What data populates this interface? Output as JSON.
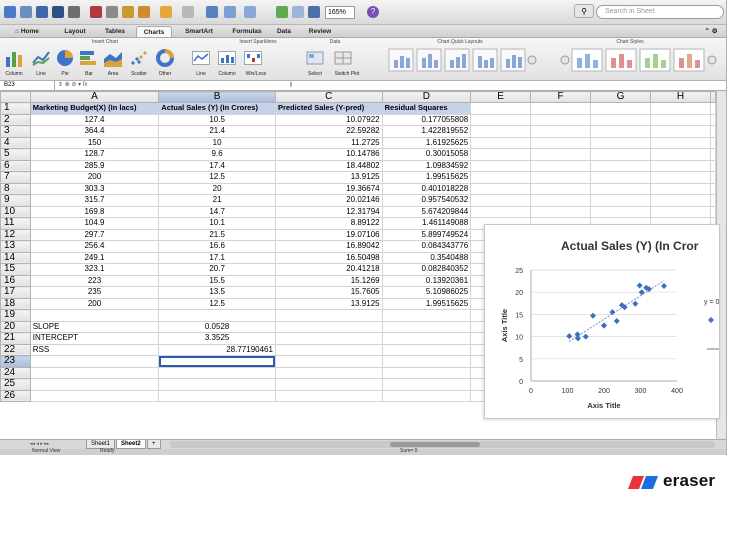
{
  "toolbar": {
    "zoom": "165%",
    "search_placeholder": "Search in Sheet",
    "help": "?"
  },
  "ribbon": {
    "tabs": [
      "Home",
      "Layout",
      "Tables",
      "Charts",
      "SmartArt",
      "Formulas",
      "Data",
      "Review"
    ],
    "active_tab": "Charts",
    "groups": [
      "Insert Chart",
      "Insert Sparklines",
      "Data",
      "Chart Quick Layouts",
      "Chart Styles"
    ],
    "buttons": [
      "Column",
      "Line",
      "Pie",
      "Bar",
      "Area",
      "Scatter",
      "Other",
      "Line",
      "Column",
      "Win/Loss",
      "Select",
      "Switch Plot"
    ]
  },
  "formula_bar": {
    "name_box": "B23",
    "fx": "fx",
    "cursor": "I"
  },
  "columns": [
    "A",
    "B",
    "C",
    "D",
    "E",
    "F",
    "G",
    "H"
  ],
  "headers": [
    "Marketing Budget(X) (In lacs)",
    "Actual Sales (Y) (In Crores)",
    "Predicted Sales (Y-pred)",
    "Residual Squares"
  ],
  "rows": [
    [
      "127.4",
      "10.5",
      "10.07922",
      "0.177055808"
    ],
    [
      "364.4",
      "21.4",
      "22.59282",
      "1.422819552"
    ],
    [
      "150",
      "10",
      "11.2725",
      "1.61925625"
    ],
    [
      "128.7",
      "9.6",
      "10.14786",
      "0.30015058"
    ],
    [
      "285.9",
      "17.4",
      "18.44802",
      "1.09834592"
    ],
    [
      "200",
      "12.5",
      "13.9125",
      "1.99515625"
    ],
    [
      "303.3",
      "20",
      "19.36674",
      "0.401018228"
    ],
    [
      "315.7",
      "21",
      "20.02146",
      "0.957540532"
    ],
    [
      "169.8",
      "14.7",
      "12.31794",
      "5.674209844"
    ],
    [
      "104.9",
      "10.1",
      "8.89122",
      "1.461149088"
    ],
    [
      "297.7",
      "21.5",
      "19.07106",
      "5.899749524"
    ],
    [
      "256.4",
      "16.6",
      "16.89042",
      "0.084343776"
    ],
    [
      "249.1",
      "17.1",
      "16.50498",
      "0.3540488"
    ],
    [
      "323.1",
      "20.7",
      "20.41218",
      "0.082840352"
    ],
    [
      "223",
      "15.5",
      "15.1269",
      "0.13920361"
    ],
    [
      "235",
      "13.5",
      "15.7605",
      "5.10986025"
    ],
    [
      "200",
      "12.5",
      "13.9125",
      "1.99515625"
    ]
  ],
  "stats": {
    "slope_label": "SLOPE",
    "slope_value": "0.0528",
    "intercept_label": "INTERCEPT",
    "intercept_value": "3.3525",
    "rss_label": "RSS",
    "rss_value": "28.77190461"
  },
  "row_numbers": [
    "1",
    "2",
    "3",
    "4",
    "5",
    "6",
    "7",
    "8",
    "9",
    "10",
    "11",
    "12",
    "13",
    "14",
    "15",
    "16",
    "17",
    "18",
    "19",
    "20",
    "21",
    "22",
    "23",
    "24",
    "25",
    "26"
  ],
  "sheets": [
    "Sheet1",
    "Sheet2",
    "+"
  ],
  "active_sheet": "Sheet2",
  "status": {
    "view": "Normal View",
    "ready": "Ready",
    "sum": "Sum= 0"
  },
  "chart_data": {
    "type": "scatter",
    "title": "Actual Sales (Y) (In Cror",
    "xlabel": "Axis Title",
    "ylabel": "Axis Title",
    "xlim": [
      0,
      400
    ],
    "ylim": [
      0,
      25
    ],
    "xticks": [
      "0",
      "100",
      "200",
      "300",
      "400"
    ],
    "yticks": [
      "0",
      "5",
      "10",
      "15",
      "20",
      "25"
    ],
    "grid": true,
    "trendline": {
      "slope": 0.0528,
      "intercept": 3.3525
    },
    "legend_snippet": "y = 0",
    "series": [
      {
        "x": [
          127.4,
          364.4,
          150,
          128.7,
          285.9,
          200,
          303.3,
          315.7,
          169.8,
          104.9,
          297.7,
          256.4,
          249.1,
          323.1,
          223,
          235,
          200
        ],
        "y": [
          10.5,
          21.4,
          10,
          9.6,
          17.4,
          12.5,
          20,
          21,
          14.7,
          10.1,
          21.5,
          16.6,
          17.1,
          20.7,
          15.5,
          13.5,
          12.5
        ]
      }
    ],
    "color": "#3b6fc2"
  },
  "brand": {
    "name": "eraser",
    "color_a": "#e8323c",
    "color_b": "#1a6ee0"
  }
}
